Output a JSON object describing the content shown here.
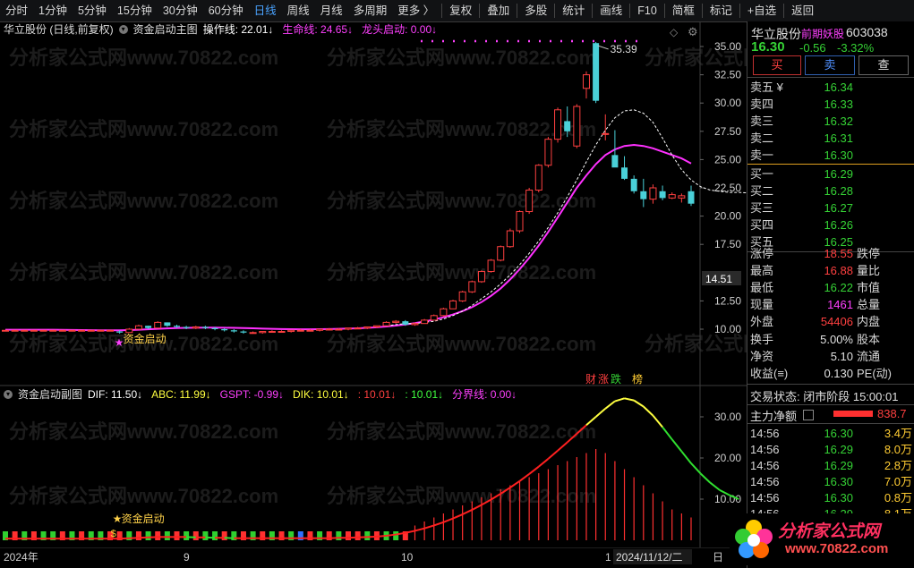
{
  "toolbar": {
    "periods": [
      "分时",
      "1分钟",
      "5分钟",
      "15分钟",
      "30分钟",
      "60分钟",
      "日线",
      "周线",
      "月线",
      "多周期",
      "更多 〉"
    ],
    "active_period": "日线",
    "tools": [
      "复权",
      "叠加",
      "多股",
      "统计",
      "画线",
      "F10",
      "简框",
      "标记",
      "+自选",
      "返回"
    ]
  },
  "main_chart": {
    "title": "华立股份 (日线,前复权)",
    "indicator_name": "资金启动主图",
    "params": [
      {
        "label": "操作线: 22.01",
        "color": "#ffffff"
      },
      {
        "label": "生命线: 24.65",
        "color": "#ff40ff"
      },
      {
        "label": "龙头启动: 0.00",
        "color": "#ff40ff"
      }
    ],
    "y_ticks": [
      "35.00",
      "32.50",
      "30.00",
      "27.50",
      "25.00",
      "22.50",
      "20.00",
      "17.50",
      "12.50",
      "10.00"
    ],
    "current_price_tag": "14.51",
    "high_label": "35.39",
    "signal_label": "资金启动",
    "badges": [
      "财",
      "涨",
      "跌",
      "榜"
    ]
  },
  "sub_chart": {
    "indicator_name": "资金启动副图",
    "params": [
      {
        "label": "DIF: 11.50",
        "color": "#ffffff"
      },
      {
        "label": "ABC: 11.99",
        "color": "#ffff40"
      },
      {
        "label": "GSPT: -0.99",
        "color": "#ff40ff"
      },
      {
        "label": "DIK: 10.01",
        "color": "#ffff40"
      },
      {
        "label": ": 10.01",
        "color": "#ff4040"
      },
      {
        "label": ": 10.01",
        "color": "#40ff40"
      },
      {
        "label": "分界线: 0.00",
        "color": "#ff40ff"
      }
    ],
    "y_ticks": [
      "30.00",
      "20.00",
      "10.00"
    ],
    "signal_label": "资金启动"
  },
  "x_axis": {
    "labels": [
      "2024年",
      "9",
      "10",
      "1",
      "2024/11/12/二"
    ],
    "right_label": "日"
  },
  "watermark": "分析家公式网www.70822.com",
  "quote": {
    "name": "华立股份",
    "tag": "前期妖股",
    "code": "603038",
    "price": "16.30",
    "change": "-0.56",
    "change_pct": "-3.32%",
    "buttons": [
      "买",
      "卖",
      "查"
    ],
    "asks": [
      {
        "label": "卖五 ¥",
        "price": "16.34"
      },
      {
        "label": "卖四",
        "price": "16.33"
      },
      {
        "label": "卖三",
        "price": "16.32"
      },
      {
        "label": "卖二",
        "price": "16.31"
      },
      {
        "label": "卖一",
        "price": "16.30"
      }
    ],
    "bids": [
      {
        "label": "买一",
        "price": "16.29"
      },
      {
        "label": "买二",
        "price": "16.28"
      },
      {
        "label": "买三",
        "price": "16.27"
      },
      {
        "label": "买四",
        "price": "16.26"
      },
      {
        "label": "买五",
        "price": "16.25"
      }
    ],
    "stats": [
      {
        "l1": "涨停",
        "v": "18.55",
        "vc": "#ff4040",
        "l2": "跌停"
      },
      {
        "l1": "最高",
        "v": "16.88",
        "vc": "#ff4040",
        "l2": "量比"
      },
      {
        "l1": "最低",
        "v": "16.22",
        "vc": "#35d235",
        "l2": "市值"
      },
      {
        "l1": "现量",
        "v": "1461",
        "vc": "#ff40ff",
        "l2": "总量"
      },
      {
        "l1": "外盘",
        "v": "54406",
        "vc": "#ff4040",
        "l2": "内盘"
      }
    ],
    "stats2": [
      {
        "l1": "换手",
        "v": "5.00%",
        "l2": "股本"
      },
      {
        "l1": "净资",
        "v": "5.10",
        "l2": "流通"
      },
      {
        "l1": "收益(≡)",
        "v": "0.130",
        "l2": "PE(动)"
      }
    ],
    "trade_status": "交易状态: 闭市阶段 15:00:01",
    "net_inflow_label": "主力净额",
    "net_inflow_value": "838.7",
    "ticks": [
      {
        "time": "14:56",
        "price": "16.30",
        "vol": "3.4万",
        "vc": "#ffcc33"
      },
      {
        "time": "14:56",
        "price": "16.29",
        "vol": "8.0万",
        "vc": "#ffcc33"
      },
      {
        "time": "14:56",
        "price": "16.29",
        "vol": "2.8万",
        "vc": "#ffcc33"
      },
      {
        "time": "14:56",
        "price": "16.30",
        "vol": "7.0万",
        "vc": "#ffcc33"
      },
      {
        "time": "14:56",
        "price": "16.30",
        "vol": "0.8万",
        "vc": "#ffcc33"
      },
      {
        "time": "14:56",
        "price": "16.29",
        "vol": "8.1万",
        "vc": "#ffcc33"
      }
    ],
    "ask_colors": [
      "#35d235",
      "#35d235",
      "#35d235",
      "#35d235",
      "#35d235"
    ],
    "bid_colors": [
      "#35d235",
      "#35d235",
      "#35d235",
      "#35d235",
      "#35d235"
    ]
  },
  "logo": {
    "text": "分析家公式网",
    "url": "www.70822.com"
  },
  "colors": {
    "up": "#ff4040",
    "down": "#4ad0d8",
    "ma_life": "#ff30ff",
    "ma_op": "#ffffff"
  },
  "chart_data": {
    "type": "candlestick",
    "candles": [
      [
        9.9,
        9.9,
        9.9,
        9.9
      ],
      [
        9.9,
        9.9,
        9.9,
        9.9
      ],
      [
        9.9,
        9.9,
        9.9,
        9.9
      ],
      [
        9.9,
        9.9,
        9.9,
        9.9
      ],
      [
        9.9,
        9.9,
        9.9,
        9.9
      ],
      [
        9.9,
        9.9,
        9.9,
        9.9
      ],
      [
        9.9,
        9.9,
        9.9,
        9.9
      ],
      [
        9.9,
        9.9,
        9.9,
        9.9
      ],
      [
        9.9,
        9.9,
        9.9,
        9.9
      ],
      [
        9.9,
        9.9,
        9.9,
        9.9
      ],
      [
        9.9,
        9.9,
        9.9,
        9.9
      ],
      [
        9.9,
        9.9,
        9.9,
        9.9
      ],
      [
        9.8,
        9.9,
        9.6,
        9.7
      ],
      [
        9.7,
        10.1,
        9.7,
        10.0
      ],
      [
        10.0,
        10.4,
        10.0,
        10.3
      ],
      [
        10.3,
        10.3,
        10.0,
        10.1
      ],
      [
        10.1,
        10.7,
        10.1,
        10.6
      ],
      [
        10.6,
        10.6,
        10.2,
        10.3
      ],
      [
        10.3,
        10.4,
        10.1,
        10.2
      ],
      [
        10.2,
        10.3,
        10.0,
        10.1
      ],
      [
        10.1,
        10.3,
        10.0,
        10.2
      ],
      [
        10.2,
        10.3,
        10.0,
        10.1
      ],
      [
        10.1,
        10.2,
        9.9,
        10.0
      ],
      [
        10.0,
        10.1,
        9.8,
        9.9
      ],
      [
        9.9,
        10.0,
        9.7,
        9.8
      ],
      [
        9.8,
        9.9,
        9.6,
        9.7
      ],
      [
        9.7,
        9.8,
        9.6,
        9.7
      ],
      [
        9.7,
        9.8,
        9.6,
        9.8
      ],
      [
        9.8,
        9.9,
        9.7,
        9.8
      ],
      [
        9.8,
        9.9,
        9.7,
        9.8
      ],
      [
        9.8,
        9.9,
        9.7,
        9.9
      ],
      [
        9.9,
        10.0,
        9.8,
        9.9
      ],
      [
        9.9,
        10.0,
        9.8,
        9.9
      ],
      [
        9.9,
        10.0,
        9.8,
        10.0
      ],
      [
        10.0,
        10.1,
        9.9,
        10.0
      ],
      [
        10.0,
        10.1,
        9.9,
        10.0
      ],
      [
        10.0,
        10.1,
        9.9,
        10.1
      ],
      [
        10.1,
        10.2,
        10.0,
        10.1
      ],
      [
        10.1,
        10.2,
        10.0,
        10.2
      ],
      [
        10.2,
        10.3,
        10.1,
        10.3
      ],
      [
        10.3,
        10.7,
        10.3,
        10.6
      ],
      [
        10.6,
        10.8,
        10.5,
        10.7
      ],
      [
        10.7,
        10.8,
        10.3,
        10.4
      ],
      [
        10.4,
        10.6,
        10.3,
        10.5
      ],
      [
        10.5,
        10.9,
        10.5,
        10.8
      ],
      [
        10.8,
        11.3,
        10.8,
        11.2
      ],
      [
        11.2,
        11.9,
        11.1,
        11.8
      ],
      [
        11.8,
        12.6,
        11.8,
        12.5
      ],
      [
        12.5,
        13.4,
        12.4,
        13.3
      ],
      [
        13.3,
        14.3,
        13.2,
        14.2
      ],
      [
        14.2,
        15.2,
        14.1,
        15.1
      ],
      [
        15.1,
        16.2,
        15.0,
        16.1
      ],
      [
        16.1,
        17.4,
        16.0,
        17.3
      ],
      [
        17.3,
        18.9,
        17.2,
        18.7
      ],
      [
        18.7,
        20.5,
        18.5,
        20.4
      ],
      [
        20.4,
        22.5,
        20.2,
        22.3
      ],
      [
        22.3,
        24.6,
        22.1,
        24.5
      ],
      [
        24.5,
        27.0,
        24.3,
        26.8
      ],
      [
        26.8,
        29.6,
        26.5,
        29.4
      ],
      [
        28.4,
        29.7,
        27.0,
        27.5
      ],
      [
        26.2,
        29.9,
        26.0,
        29.7
      ],
      [
        31.3,
        32.8,
        30.4,
        32.5
      ],
      [
        35.3,
        35.4,
        30.0,
        30.2
      ],
      [
        27.3,
        29.0,
        26.7,
        27.3
      ],
      [
        25.4,
        27.6,
        24.5,
        24.3
      ],
      [
        24.3,
        25.3,
        23.2,
        23.3
      ],
      [
        23.3,
        23.6,
        22.0,
        22.2
      ],
      [
        22.2,
        23.3,
        20.8,
        21.5
      ],
      [
        21.5,
        22.8,
        21.1,
        22.5
      ],
      [
        22.2,
        22.7,
        21.4,
        21.6
      ],
      [
        21.6,
        22.1,
        21.5,
        21.9
      ],
      [
        21.6,
        22.0,
        21.2,
        21.8
      ],
      [
        22.2,
        22.7,
        20.9,
        21.1
      ]
    ],
    "ma_life": [
      9.95,
      9.95,
      9.95,
      9.95,
      9.95,
      9.95,
      9.94,
      9.93,
      9.92,
      9.91,
      9.9,
      9.9,
      9.9,
      9.92,
      9.95,
      9.99,
      10.03,
      10.07,
      10.1,
      10.12,
      10.13,
      10.14,
      10.14,
      10.13,
      10.12,
      10.1,
      10.08,
      10.05,
      10.03,
      10.01,
      10.0,
      9.99,
      9.99,
      10.0,
      10.01,
      10.03,
      10.05,
      10.08,
      10.12,
      10.17,
      10.24,
      10.32,
      10.42,
      10.54,
      10.68,
      10.85,
      11.05,
      11.3,
      11.6,
      11.95,
      12.4,
      12.95,
      13.6,
      14.4,
      15.3,
      16.3,
      17.4,
      18.6,
      19.9,
      21.2,
      22.5,
      23.6,
      24.6,
      25.4,
      25.9,
      26.2,
      26.3,
      26.2,
      26.0,
      25.7,
      25.4,
      25.1,
      24.65
    ],
    "ma_op_start": 40,
    "ma_op": [
      10.3,
      10.4,
      10.5,
      10.5,
      10.6,
      10.7,
      10.9,
      11.2,
      11.6,
      12.1,
      12.7,
      13.3,
      14.0,
      14.8,
      15.7,
      16.7,
      17.8,
      19.0,
      20.3,
      21.7,
      23.2,
      24.8,
      26.3,
      27.6,
      28.7,
      29.3,
      29.4,
      29.1,
      28.3,
      26.9,
      25.4,
      24.1,
      23.2,
      22.6,
      22.3,
      22.2,
      22.1,
      22.1,
      22.05,
      22.01
    ],
    "sub_line": [
      0.4,
      0.4,
      0.4,
      0.4,
      0.4,
      0.4,
      0.4,
      0.4,
      0.4,
      0.4,
      0.4,
      0.4,
      0.4,
      0.5,
      0.6,
      0.7,
      0.8,
      0.8,
      0.8,
      0.8,
      0.7,
      0.7,
      0.6,
      0.6,
      0.5,
      0.5,
      0.5,
      0.5,
      0.5,
      0.5,
      0.5,
      0.5,
      0.5,
      0.5,
      0.5,
      0.6,
      0.6,
      0.7,
      0.8,
      0.9,
      1.1,
      1.4,
      1.8,
      2.3,
      2.9,
      3.6,
      4.4,
      5.3,
      6.3,
      7.4,
      8.6,
      9.9,
      11.3,
      12.8,
      14.4,
      16.1,
      17.9,
      19.8,
      21.8,
      23.8,
      25.9,
      28.0,
      30.0,
      32.0,
      33.8,
      34.5,
      34.0,
      32.5,
      30.3,
      27.5,
      24.5,
      21.6,
      18.7,
      16.2,
      14.0,
      12.2,
      11.0,
      10.0
    ],
    "sub_bars": [
      2.5,
      1.8,
      2.5,
      2.0,
      2.5,
      2.4,
      2.5,
      1.6,
      2.5,
      2.2,
      2.5,
      1.9,
      2.5,
      2.4,
      2.2,
      2.5,
      1.8,
      2.5,
      2.1,
      2.5,
      1.7,
      2.5,
      2.3,
      2.5,
      1.9,
      2.5,
      2.2,
      2.5,
      1.8,
      2.5,
      2.4,
      2.5,
      2.0,
      2.5,
      1.6,
      2.5,
      2.3,
      2.5,
      2.1,
      2.5,
      2.5,
      2.5,
      2.5,
      3.0,
      3.5,
      4.0,
      4.5,
      5.0,
      5.5,
      6.0,
      6.5,
      7.0,
      7.5,
      8.0,
      8.5,
      9.0,
      9.5,
      10.0,
      10.5,
      11.0,
      11.5,
      12.0,
      12.5,
      12.0,
      11.0,
      10.0,
      9.0,
      8.0,
      7.0,
      6.0,
      5.0,
      4.5,
      4.0
    ],
    "sub_bar_colors": [
      "g",
      "r",
      "g",
      "r",
      "g",
      "g",
      "r",
      "g",
      "r",
      "g",
      "g",
      "r",
      "r",
      "g",
      "r",
      "g",
      "r",
      "g",
      "r",
      "g",
      "r",
      "g",
      "g",
      "r",
      "g",
      "r",
      "g",
      "r",
      "g",
      "r",
      "g",
      "b",
      "r",
      "g",
      "r",
      "g",
      "r",
      "r",
      "g",
      "r",
      "g",
      "g",
      "r",
      "r",
      "r",
      "r",
      "r",
      "r",
      "r",
      "r",
      "r",
      "r",
      "r",
      "r",
      "r",
      "r",
      "r",
      "r",
      "r",
      "r",
      "r",
      "r",
      "r",
      "r",
      "r",
      "r",
      "r",
      "r",
      "r",
      "r",
      "r",
      "r",
      "r"
    ]
  }
}
